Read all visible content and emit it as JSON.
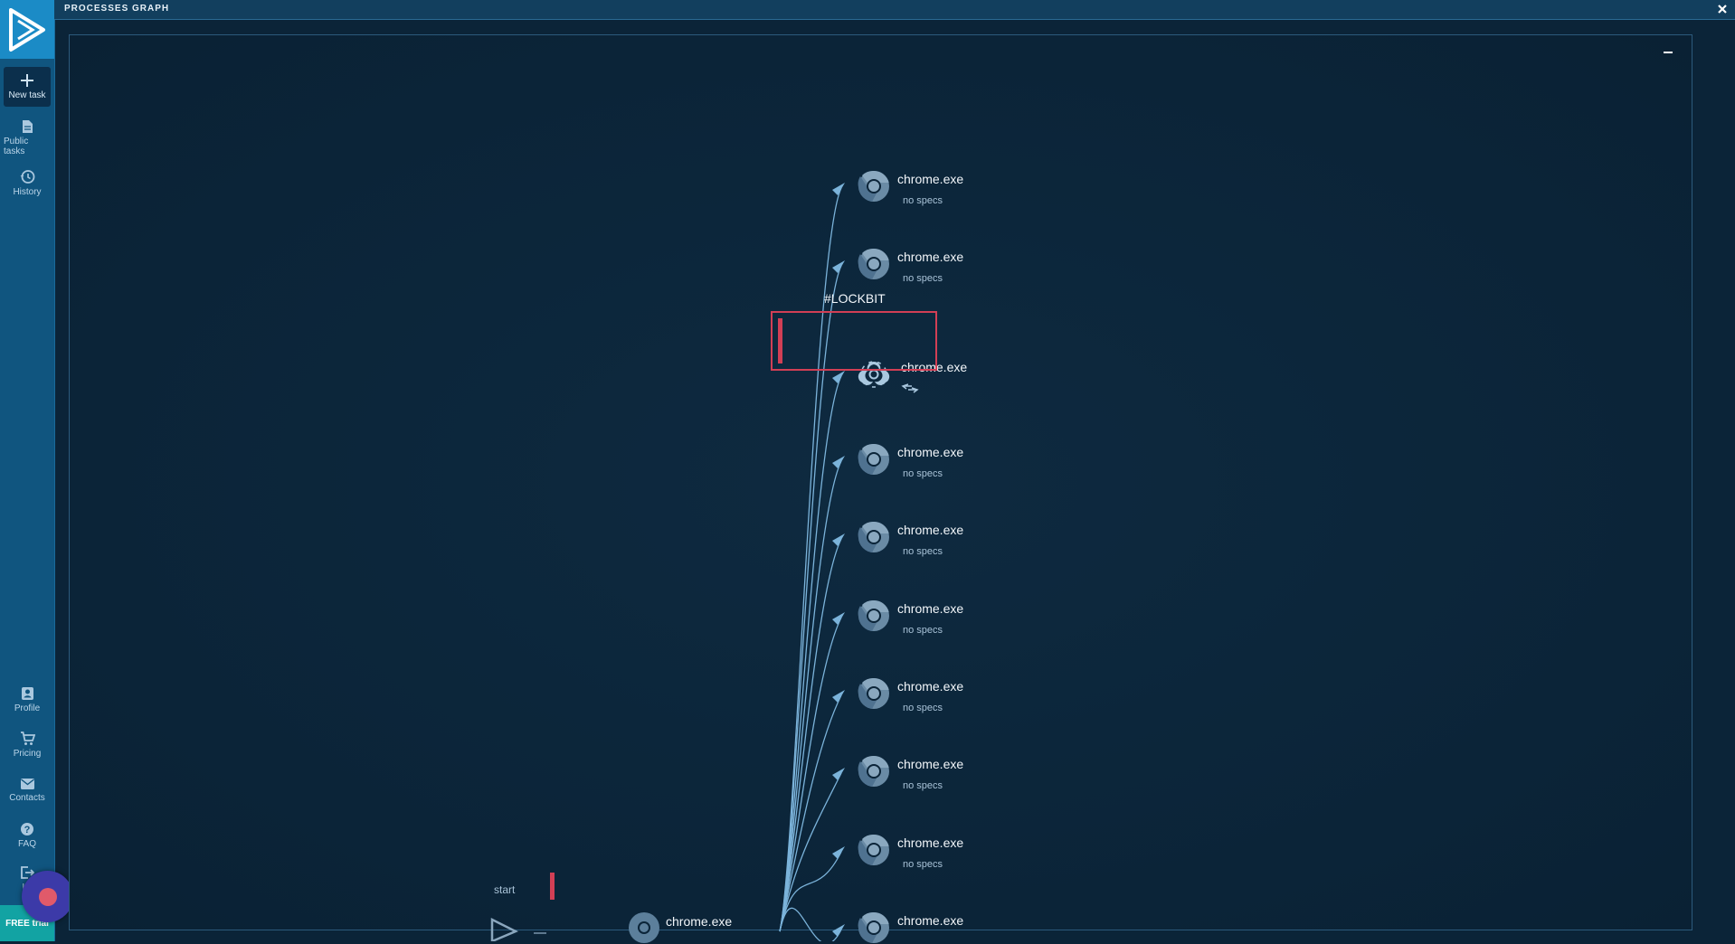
{
  "header": {
    "title": "PROCESSES GRAPH"
  },
  "sidebar": {
    "items": [
      {
        "label": "New task",
        "icon": "plus-icon"
      },
      {
        "label": "Public tasks",
        "icon": "document-icon"
      },
      {
        "label": "History",
        "icon": "history-icon"
      },
      {
        "label": "Profile",
        "icon": "profile-icon"
      },
      {
        "label": "Pricing",
        "icon": "cart-icon"
      },
      {
        "label": "Contacts",
        "icon": "mail-icon"
      },
      {
        "label": "FAQ",
        "icon": "help-icon"
      },
      {
        "label": "Lo",
        "icon": "logout-icon"
      }
    ],
    "free_trial": "FREE trial"
  },
  "graph": {
    "malicious_tag": "#LOCKBIT",
    "start_label": "start",
    "nodes": [
      {
        "name": "chrome.exe",
        "spec": "no specs"
      },
      {
        "name": "chrome.exe",
        "spec": "no specs"
      },
      {
        "name": "chrome.exe",
        "spec": "",
        "malicious": true
      },
      {
        "name": "chrome.exe",
        "spec": "no specs"
      },
      {
        "name": "chrome.exe",
        "spec": "no specs"
      },
      {
        "name": "chrome.exe",
        "spec": "no specs"
      },
      {
        "name": "chrome.exe",
        "spec": "no specs"
      },
      {
        "name": "chrome.exe",
        "spec": "no specs"
      },
      {
        "name": "chrome.exe",
        "spec": "no specs"
      },
      {
        "name": "chrome.exe",
        "spec": ""
      }
    ],
    "root": {
      "name": "chrome.exe"
    }
  },
  "colors": {
    "accent": "#1b8bc6",
    "malicious": "#d23f55",
    "edge": "#7bb3da"
  }
}
